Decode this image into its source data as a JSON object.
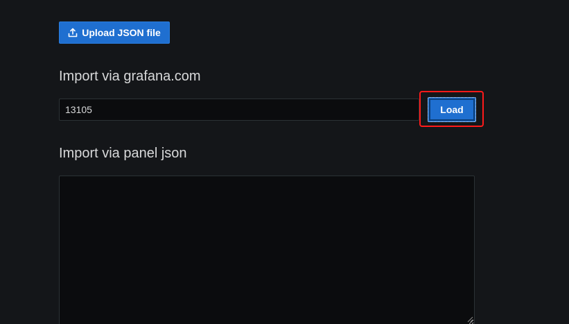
{
  "upload": {
    "label": "Upload JSON file",
    "icon": "upload-icon"
  },
  "grafana_import": {
    "title": "Import via grafana.com",
    "input_value": "13105",
    "load_label": "Load"
  },
  "panel_import": {
    "title": "Import via panel json",
    "textarea_value": ""
  },
  "colors": {
    "background": "#141619",
    "primary_button": "#1f6fd0",
    "highlight_border": "#ff1a1a",
    "input_background": "#0b0c0e"
  }
}
